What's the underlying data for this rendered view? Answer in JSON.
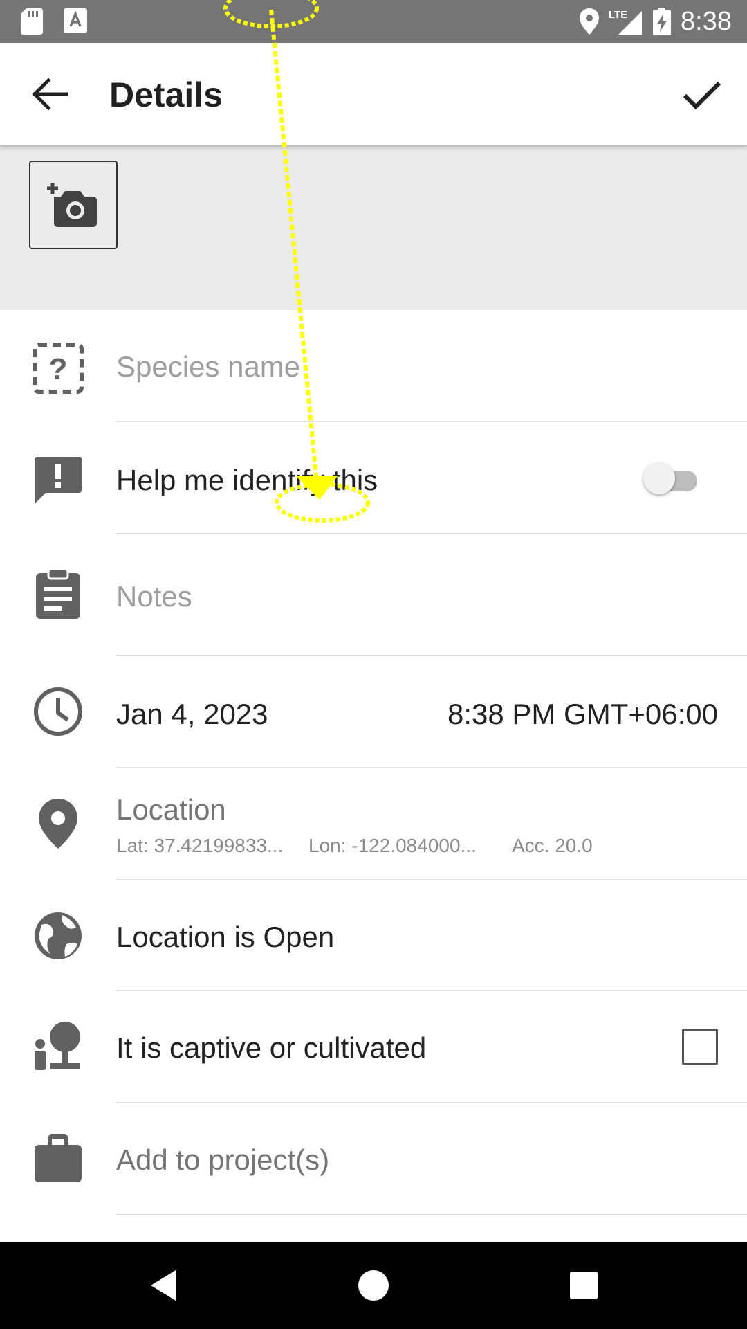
{
  "status_bar": {
    "time": "8:38",
    "network": "LTE",
    "icons": [
      "sd-card-icon",
      "keyboard-a-icon",
      "location-pin-icon",
      "signal-icon",
      "battery-charging-icon"
    ]
  },
  "app_bar": {
    "title": "Details",
    "back_icon": "arrow-back-icon",
    "confirm_icon": "check-icon"
  },
  "photo": {
    "add_icon": "add-a-photo-icon"
  },
  "fields": {
    "species_placeholder": "Species name",
    "help_identify_label": "Help me identify this",
    "help_identify_on": false,
    "notes_placeholder": "Notes",
    "date": "Jan 4, 2023",
    "time": "8:38 PM GMT+06:00",
    "location_label": "Location",
    "location_lat": "Lat: 37.42199833...",
    "location_lon": "Lon: -122.084000...",
    "location_acc": "Acc. 20.0",
    "geoprivacy": "Location is Open",
    "captive_label": "It is captive or cultivated",
    "captive_checked": false,
    "projects_placeholder": "Add to project(s)"
  },
  "colors": {
    "status_bar": "#757575",
    "text_primary": "#212121",
    "text_hint": "#9e9e9e",
    "icon": "#616161",
    "photo_bg": "#ebebeb",
    "overlay": "#ffff00"
  }
}
